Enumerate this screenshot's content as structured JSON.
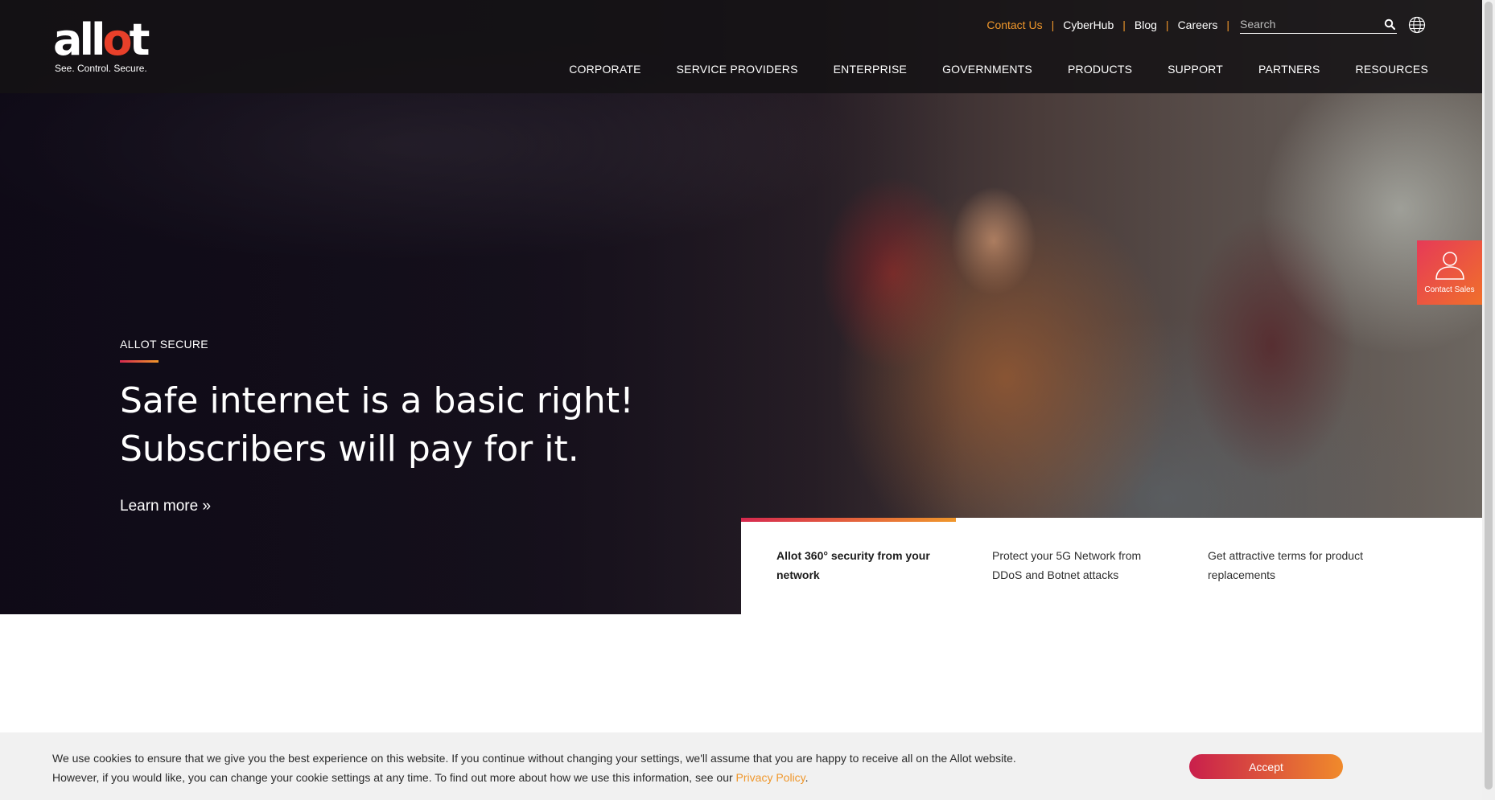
{
  "brand": {
    "logo_text": "allot",
    "tagline": "See. Control. Secure."
  },
  "utility_nav": {
    "items": [
      {
        "label": "Contact Us",
        "accent": true
      },
      {
        "label": "CyberHub"
      },
      {
        "label": "Blog"
      },
      {
        "label": "Careers"
      }
    ],
    "search_placeholder": "Search",
    "search_icon": "search-icon",
    "language_icon": "globe-icon"
  },
  "main_nav": {
    "items": [
      "CORPORATE",
      "SERVICE PROVIDERS",
      "ENTERPRISE",
      "GOVERNMENTS",
      "PRODUCTS",
      "SUPPORT",
      "PARTNERS",
      "RESOURCES"
    ]
  },
  "hero": {
    "eyebrow": "ALLOT SECURE",
    "headline_line1": "Safe internet is a basic right!",
    "headline_line2": "Subscribers will pay for it.",
    "cta": "Learn more »"
  },
  "features": [
    {
      "text": "Allot 360° security from your network",
      "active": true
    },
    {
      "text": "Protect your 5G Network from DDoS and Botnet attacks",
      "active": false
    },
    {
      "text": "Get attractive terms for product replacements",
      "active": false
    }
  ],
  "contact_sales": {
    "label": "Contact Sales",
    "icon": "user-icon"
  },
  "cookie_banner": {
    "text_line1": "We use cookies to ensure that we give you the best experience on this website. If you continue without changing your settings, we'll assume that you are happy to receive all on the Allot website.",
    "text_line2": "However, if you would like, you can change your cookie settings at any time. To find out more about how we use this information, see our",
    "link": "Privacy Policy",
    "after_link": ".",
    "accept": "Accept"
  },
  "colors": {
    "accent_orange": "#f0972b",
    "accent_red": "#d6294f",
    "logo_o": "#e8402a"
  }
}
